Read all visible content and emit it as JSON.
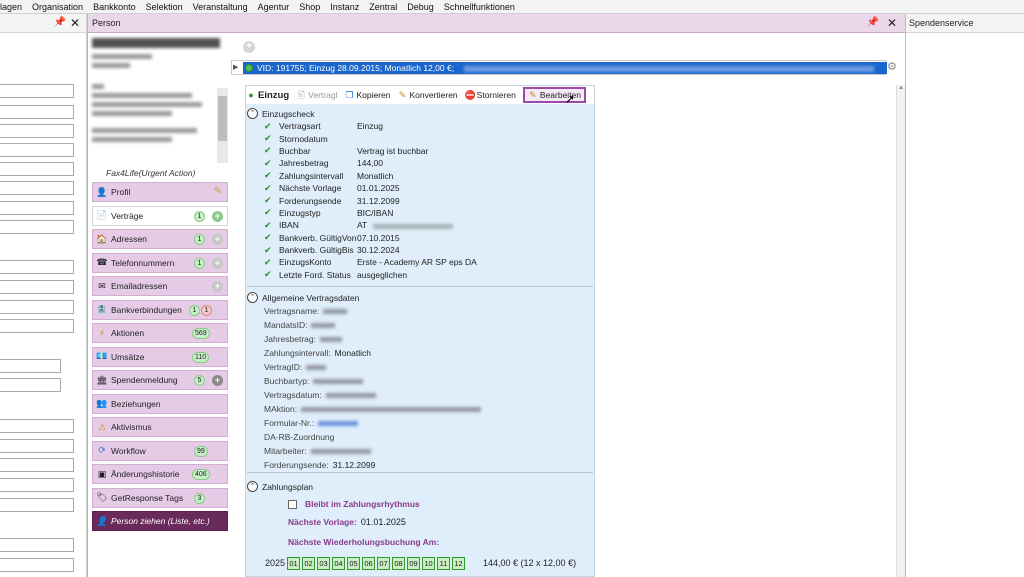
{
  "menu": [
    "lagen",
    "Organisation",
    "Bankkonto",
    "Selektion",
    "Veranstaltung",
    "Agentur",
    "Shop",
    "Instanz",
    "Zentral",
    "Debug",
    "Schnellfunktionen"
  ],
  "panels": {
    "person_title": "Person",
    "right_title": "Spendenservice"
  },
  "nav": {
    "header": "Fax4Life(Urgent Action)",
    "items": [
      {
        "label": "Profil",
        "icon": "user-icon"
      },
      {
        "label": "Verträge",
        "icon": "contract-icon",
        "badge": "1"
      },
      {
        "label": "Adressen",
        "icon": "house-icon",
        "badge": "1"
      },
      {
        "label": "Telefonnummern",
        "icon": "phone-icon",
        "badge": "1"
      },
      {
        "label": "Emailadressen",
        "icon": "email-icon"
      },
      {
        "label": "Bankverbindungen",
        "icon": "bank-icon",
        "badge": "1",
        "badge2": "1"
      },
      {
        "label": "Aktionen",
        "icon": "bolt-icon",
        "badge": "569"
      },
      {
        "label": "Umsätze",
        "icon": "money-icon",
        "badge": "110"
      },
      {
        "label": "Spendenmeldung",
        "icon": "building-icon",
        "badge": "5"
      },
      {
        "label": "Beziehungen",
        "icon": "people-icon"
      },
      {
        "label": "Aktivismus",
        "icon": "warning-icon"
      },
      {
        "label": "Workflow",
        "icon": "workflow-icon",
        "badge": "99"
      },
      {
        "label": "Änderungshistorie",
        "icon": "history-icon",
        "badge": "406"
      },
      {
        "label": "GetResponse Tags",
        "icon": "tag-icon",
        "badge": "3"
      },
      {
        "label": "Person ziehen (Liste, etc.)",
        "icon": "pull-person-icon"
      }
    ]
  },
  "contract": {
    "summary": "VID: 191755; Einzug 28.09.2015; Monatlich 12,00 €;"
  },
  "toolbar": {
    "einzug": "Einzug",
    "vertragl": "Vertragl",
    "kopieren": "Kopieren",
    "konvertieren": "Konvertieren",
    "stornieren": "Stornieren",
    "bearbeiten": "Bearbeiten"
  },
  "einzugscheck": {
    "title": "Einzugscheck",
    "rows": [
      {
        "label": "Vertragsart",
        "value": "Einzug"
      },
      {
        "label": "Stornodatum",
        "value": ""
      },
      {
        "label": "Buchbar",
        "value": "Vertrag ist buchbar"
      },
      {
        "label": "Jahresbetrag",
        "value": "144,00"
      },
      {
        "label": "Zahlungsintervall",
        "value": "Monatlich"
      },
      {
        "label": "Nächste Vorlage",
        "value": "01.01.2025"
      },
      {
        "label": "Forderungsende",
        "value": "31.12.2099"
      },
      {
        "label": "Einzugstyp",
        "value": "BIC/IBAN"
      },
      {
        "label": "IBAN",
        "value": "AT"
      },
      {
        "label": "Bankverb. GültigVon",
        "value": "07.10.2015"
      },
      {
        "label": "Bankverb. GültigBis",
        "value": "30.12.2024"
      },
      {
        "label": "EinzugsKonto",
        "value": "Erste - Academy AR SP eps DA"
      },
      {
        "label": "Letzte Ford. Status",
        "value": "ausgeglichen"
      }
    ]
  },
  "vertragsdaten": {
    "title": "Allgemeine Vertragsdaten",
    "rows": [
      {
        "label": "Vertragsname:",
        "value": ""
      },
      {
        "label": "MandatsID:",
        "value": ""
      },
      {
        "label": "Jahresbetrag:",
        "value": ""
      },
      {
        "label": "Zahlungsintervall:",
        "value": "Monatlich"
      },
      {
        "label": "VertragID:",
        "value": ""
      },
      {
        "label": "Buchbartyp:",
        "value": ""
      },
      {
        "label": "Vertragsdatum:",
        "value": ""
      },
      {
        "label": "MAktion:",
        "value": ""
      },
      {
        "label": "Formular-Nr.:",
        "value": ""
      },
      {
        "label": "DA-RB-Zuordnung",
        "value": ""
      },
      {
        "label": "Mitarbeiter:",
        "value": ""
      },
      {
        "label": "Forderungsende:",
        "value": "31.12.2099"
      }
    ]
  },
  "zahlungsplan": {
    "title": "Zahlungsplan",
    "bleibt": "Bleibt im Zahlungsrhythmus",
    "naechste_label": "Nächste Vorlage:",
    "naechste_value": "01.01.2025",
    "wiederholung": "Nächste Wiederholungsbuchung Am:",
    "year": "2025",
    "months": [
      "01",
      "02",
      "03",
      "04",
      "05",
      "06",
      "07",
      "08",
      "09",
      "10",
      "11",
      "12"
    ],
    "total": "144,00 € (12 x 12,00 €)"
  }
}
